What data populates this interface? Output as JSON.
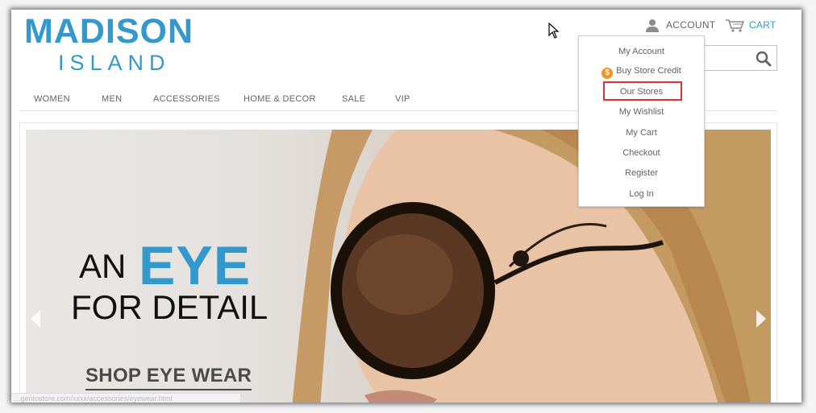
{
  "logo": {
    "main": "MADISON",
    "sub": "ISLAND"
  },
  "header": {
    "account_label": "ACCOUNT",
    "cart_label": "CART"
  },
  "icons": {
    "account": "user-icon",
    "cart": "cart-icon",
    "search": "search-icon",
    "store_credit": "dollar-coin-icon",
    "cursor": "mouse-pointer-icon"
  },
  "search": {
    "placeholder": ""
  },
  "nav": {
    "items": [
      "WOMEN",
      "MEN",
      "ACCESSORIES",
      "HOME & DECOR",
      "SALE",
      "VIP"
    ]
  },
  "account_menu": {
    "items": [
      "My Account",
      "Buy Store Credit",
      "Our Stores",
      "My Wishlist",
      "My Cart",
      "Checkout",
      "Register",
      "Log In"
    ],
    "highlighted": "Our Stores",
    "coin_symbol": "$"
  },
  "hero": {
    "line1a": "AN",
    "line1b": "EYE",
    "line2": "FOR DETAIL",
    "cta": "SHOP EYE WEAR"
  },
  "status_bar": {
    "url": "...gentostore.com/xxxx/accessories/eyewear.html"
  },
  "colors": {
    "brand": "#3399cc",
    "text": "#636363",
    "highlight": "#dd3333",
    "coin": "#f39325"
  }
}
